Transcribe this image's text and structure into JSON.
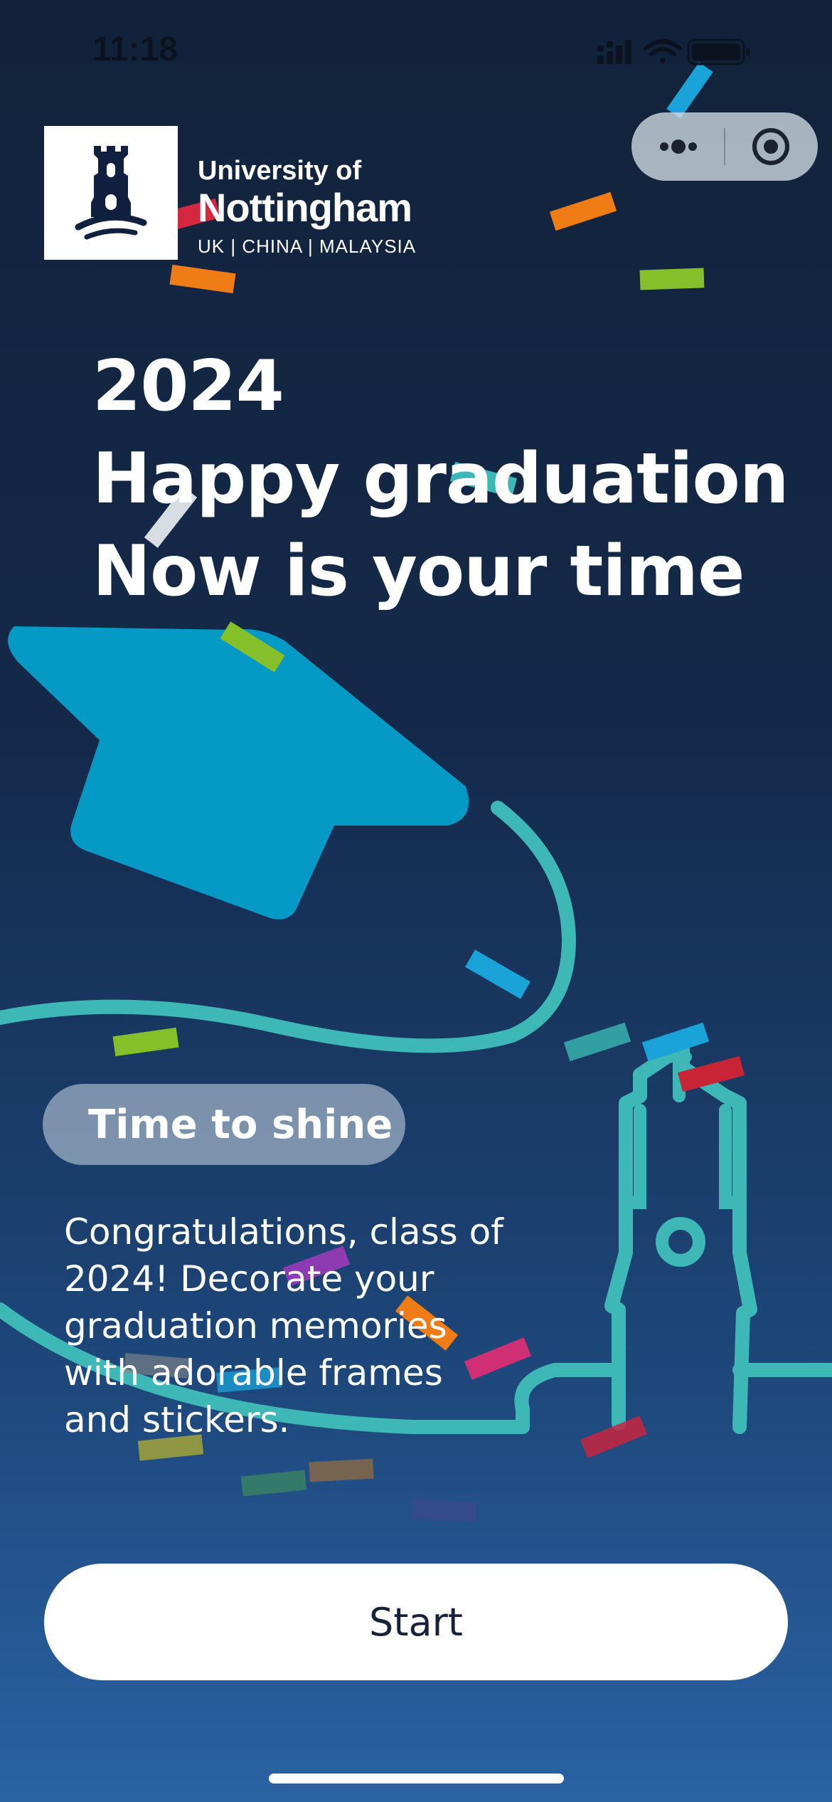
{
  "status_bar": {
    "time": "11:18",
    "icons": [
      "signal-icon",
      "wifi-icon",
      "battery-icon"
    ]
  },
  "capsule": {
    "icons": [
      "menu-dots-icon",
      "close-target-icon"
    ]
  },
  "logo": {
    "line1": "University of",
    "line2": "Nottingham",
    "line3": "UK | CHINA | MALAYSIA",
    "emblem_icon": "castle-tower-icon"
  },
  "headline": {
    "year": "2024",
    "line2": "Happy graduation",
    "line3": "Now is your time"
  },
  "tag": {
    "label": "Time to shine"
  },
  "description": "Congratulations, class of 2024! Decorate your graduation memories with adorable frames and stickers.",
  "start_button": {
    "label": "Start"
  },
  "colors": {
    "background_top": "#12223a",
    "background_bottom": "#2a62a3",
    "cap_blue": "#0599c6",
    "line_teal": "#3db8b6",
    "button_white": "#ffffff"
  }
}
